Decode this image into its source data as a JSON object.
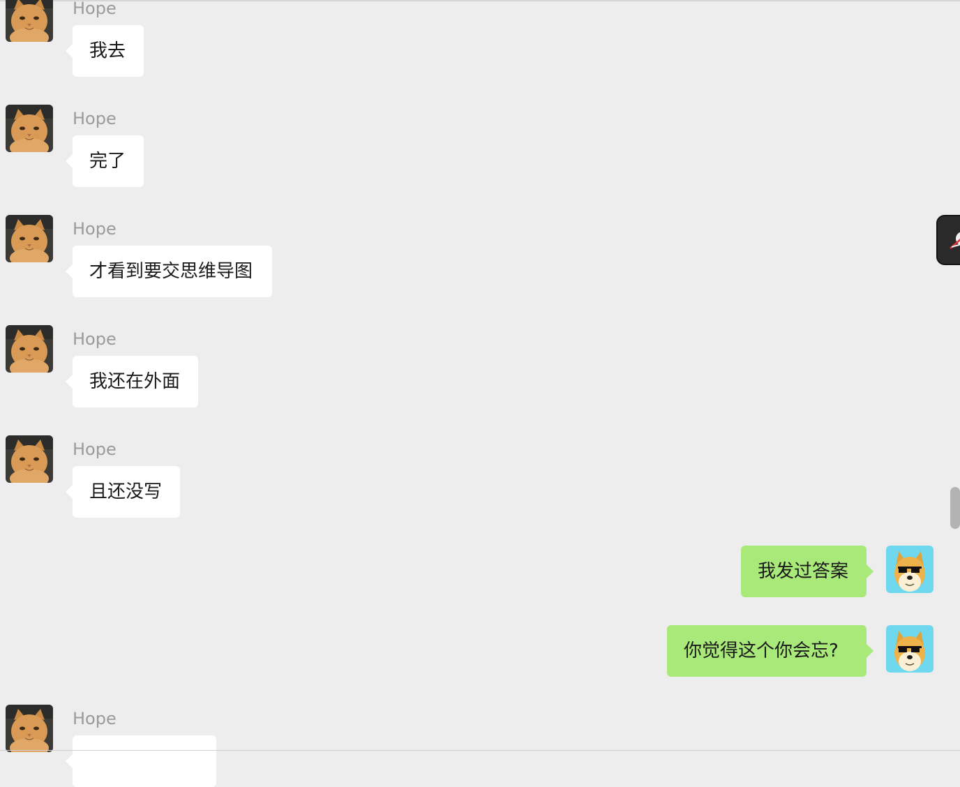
{
  "chat": {
    "messages": [
      {
        "sender": "Hope",
        "text": "我去"
      },
      {
        "sender": "Hope",
        "text": "完了"
      },
      {
        "sender": "Hope",
        "text": "才看到要交思维导图"
      },
      {
        "sender": "Hope",
        "text": "我还在外面"
      },
      {
        "sender": "Hope",
        "text": "且还没写"
      },
      {
        "sender": "me",
        "text": "我发过答案"
      },
      {
        "sender": "me",
        "text": "你觉得这个你会忘?"
      },
      {
        "sender": "Hope",
        "text": ""
      }
    ]
  },
  "icons": {
    "incoming_avatar": "orange-cat-avatar-icon",
    "outgoing_avatar": "doge-sunglasses-avatar-icon",
    "floating_widget": "floating-widget-icon"
  },
  "colors": {
    "background": "#ededed",
    "incoming_bubble": "#ffffff",
    "outgoing_bubble": "#a9e97a",
    "sender_name": "#9b9b9b"
  }
}
